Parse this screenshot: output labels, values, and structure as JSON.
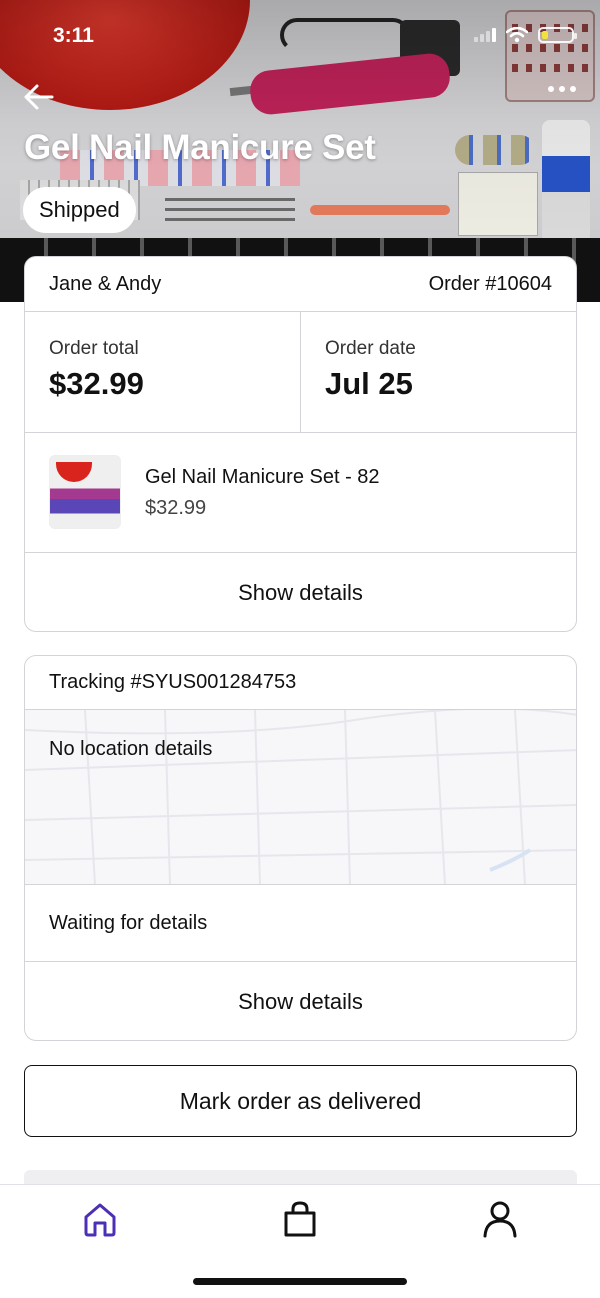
{
  "status_bar": {
    "time": "3:11"
  },
  "hero": {
    "title": "Gel Nail Manicure Set",
    "status": "Shipped"
  },
  "order": {
    "customer": "Jane & Andy",
    "order_number": "Order #10604",
    "total_label": "Order total",
    "total_value": "$32.99",
    "date_label": "Order date",
    "date_value": "Jul 25",
    "product_name": "Gel Nail Manicure Set - 82",
    "product_price": "$32.99",
    "details_label": "Show details"
  },
  "tracking": {
    "number": "Tracking #SYUS001284753",
    "map_message": "No location details",
    "waiting": "Waiting for details",
    "details_label": "Show details"
  },
  "actions": {
    "mark_delivered": "Mark order as delivered"
  },
  "tabbar": {
    "items": [
      {
        "icon": "home-icon",
        "active": true
      },
      {
        "icon": "shopping-bag-icon",
        "active": false
      },
      {
        "icon": "profile-icon",
        "active": false
      }
    ]
  },
  "colors": {
    "accent": "#4b2fb5",
    "text": "#111111",
    "border": "#d4d4d8"
  }
}
